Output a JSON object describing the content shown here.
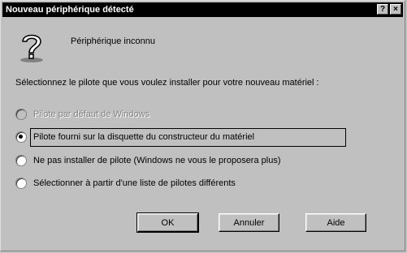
{
  "window": {
    "title": "Nouveau périphérique détecté",
    "help_button": "?",
    "close_button": "×"
  },
  "device": {
    "label": "Périphérique inconnu",
    "icon": "question-mark-icon"
  },
  "instruction": "Sélectionnez le pilote que vous voulez installer pour votre nouveau matériel :",
  "options": [
    {
      "label": "Pilote par défaut de Windows",
      "checked": false,
      "disabled": true
    },
    {
      "label": "Pilote fourni sur la disquette du constructeur du matériel",
      "checked": true,
      "disabled": false
    },
    {
      "label": "Ne pas installer de pilote (Windows ne vous le proposera plus)",
      "checked": false,
      "disabled": false
    },
    {
      "label": "Sélectionner à partir d'une liste de pilotes différents",
      "checked": false,
      "disabled": false
    }
  ],
  "buttons": {
    "ok": "OK",
    "cancel": "Annuler",
    "help": "Aide"
  }
}
